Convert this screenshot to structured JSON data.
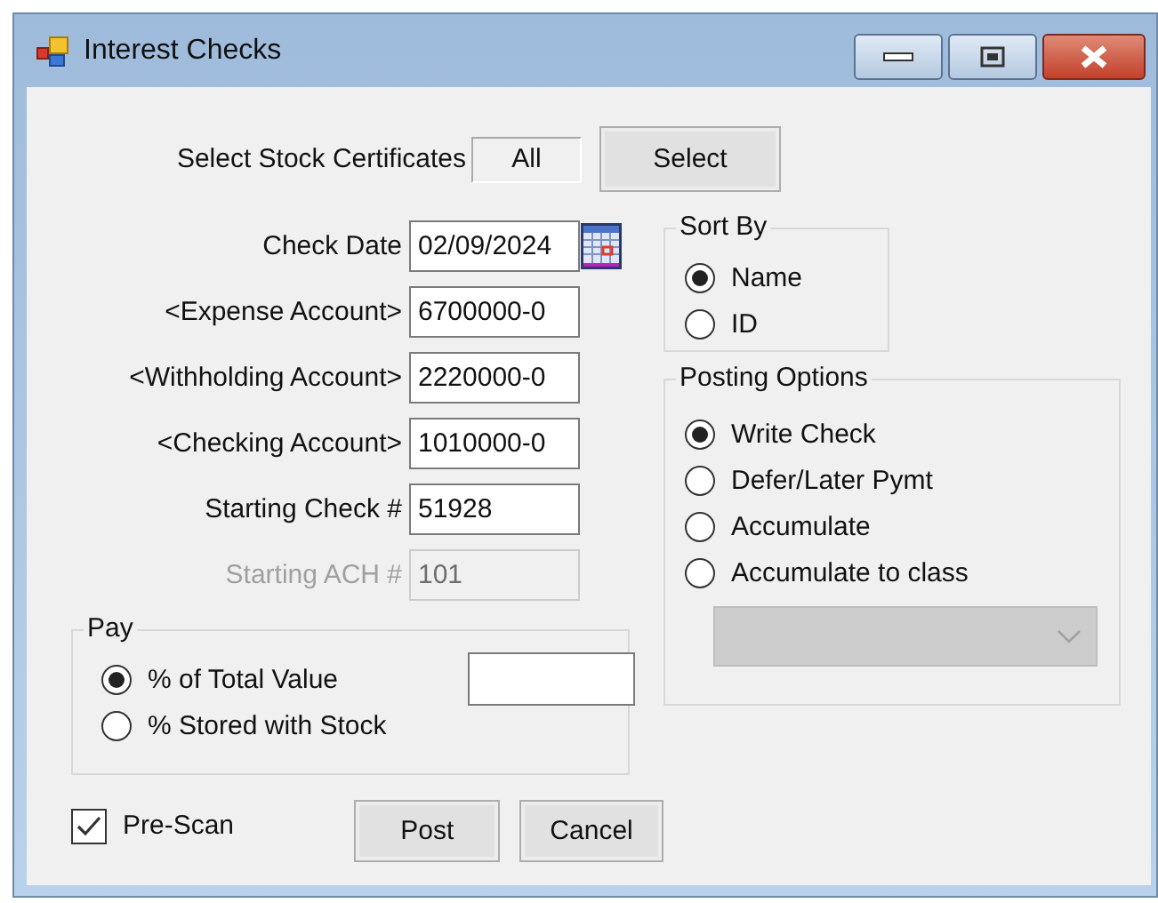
{
  "window": {
    "title": "Interest Checks"
  },
  "stock_certificates": {
    "label": "Select Stock Certificates",
    "value": "All",
    "button": "Select"
  },
  "fields": [
    {
      "label": "Check Date",
      "value": "02/09/2024",
      "disabled": false,
      "kind": "date"
    },
    {
      "label": "<Expense Account>",
      "value": "6700000-0",
      "disabled": false,
      "kind": "text"
    },
    {
      "label": "<Withholding Account>",
      "value": "2220000-0",
      "disabled": false,
      "kind": "text"
    },
    {
      "label": "<Checking Account>",
      "value": "1010000-0",
      "disabled": false,
      "kind": "text"
    },
    {
      "label": "Starting Check #",
      "value": "51928",
      "disabled": false,
      "kind": "text"
    },
    {
      "label": "Starting ACH #",
      "value": "101",
      "disabled": true,
      "kind": "text"
    }
  ],
  "sort_by": {
    "title": "Sort By",
    "options": [
      {
        "label": "Name",
        "selected": true
      },
      {
        "label": "ID",
        "selected": false
      }
    ]
  },
  "posting_options": {
    "title": "Posting Options",
    "options": [
      {
        "label": "Write Check",
        "selected": true
      },
      {
        "label": "Defer/Later Pymt",
        "selected": false
      },
      {
        "label": "Accumulate",
        "selected": false
      },
      {
        "label": "Accumulate to class",
        "selected": false
      }
    ],
    "class_dropdown": {
      "disabled": true
    }
  },
  "pay": {
    "title": "Pay",
    "options": [
      {
        "label": "% of Total Value",
        "selected": true
      },
      {
        "label": "% Stored with Stock",
        "selected": false
      }
    ]
  },
  "pre_scan": {
    "label": "Pre-Scan",
    "checked": true
  },
  "buttons": [
    "Post",
    "Cancel"
  ]
}
